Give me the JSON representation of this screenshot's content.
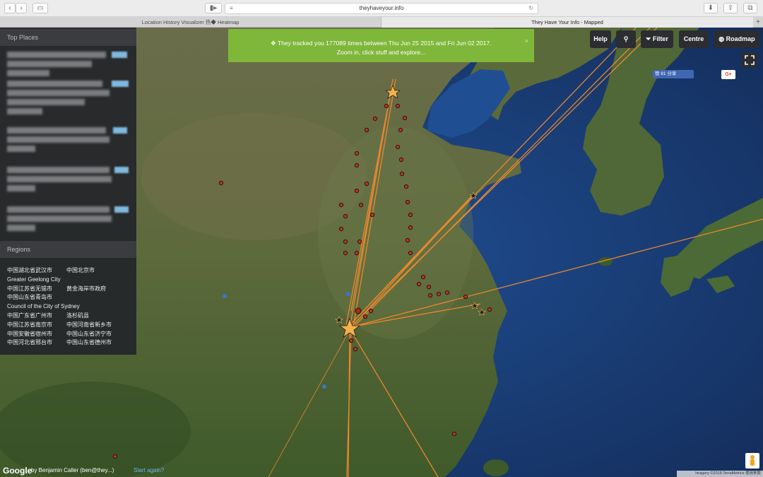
{
  "browser": {
    "url": "theyhaveyour.info",
    "tabs": [
      {
        "label": "Location History Visualizer 热◆ Heatmap",
        "active": false
      },
      {
        "label": "They Have Your Info - Mapped",
        "active": true
      }
    ],
    "new_tab_label": "+"
  },
  "sidebar": {
    "top_places_header": "Top Places",
    "regions_header": "Regions",
    "regions": [
      [
        "中国湖北省武汉市",
        "中国北京市"
      ],
      [
        "Greater Geelong City"
      ],
      [
        "中国江苏省无锡市",
        "黄金海岸市政府"
      ],
      [
        "中国山东省青岛市"
      ],
      [
        "Council of the City of Sydney"
      ],
      [
        "中国广东省广州市",
        "洛杉矶县"
      ],
      [
        "中国江苏省南京市",
        "中国河南省新乡市"
      ],
      [
        "中国安徽省宿州市",
        "中国山东省济宁市"
      ],
      [
        "中国河北省邢台市",
        "中国山东省德州市"
      ]
    ]
  },
  "banner": {
    "line1": "✥ They tracked you 177089 times between Thu Jun 25 2015 and Fri Jun 02 2017.",
    "line2": "Zoom in, click stuff and explore...",
    "close": "×"
  },
  "controls": {
    "help": "Help",
    "filter": "Filter",
    "centre": "Centre",
    "roadmap": "Roadmap"
  },
  "social": {
    "like": "赞 81  分享",
    "gplus": "G+"
  },
  "footer": {
    "google": "Google",
    "byline": "by Benjamin Caller (ben@they...)",
    "start_again": "Start again?",
    "attribution": "Imagery ©2018 TerraMetrics   使用条款"
  },
  "colors": {
    "track_line": "#f08a2c",
    "banner": "#7fb73a",
    "sea": "#1b3f7a",
    "land": "#58643a"
  }
}
